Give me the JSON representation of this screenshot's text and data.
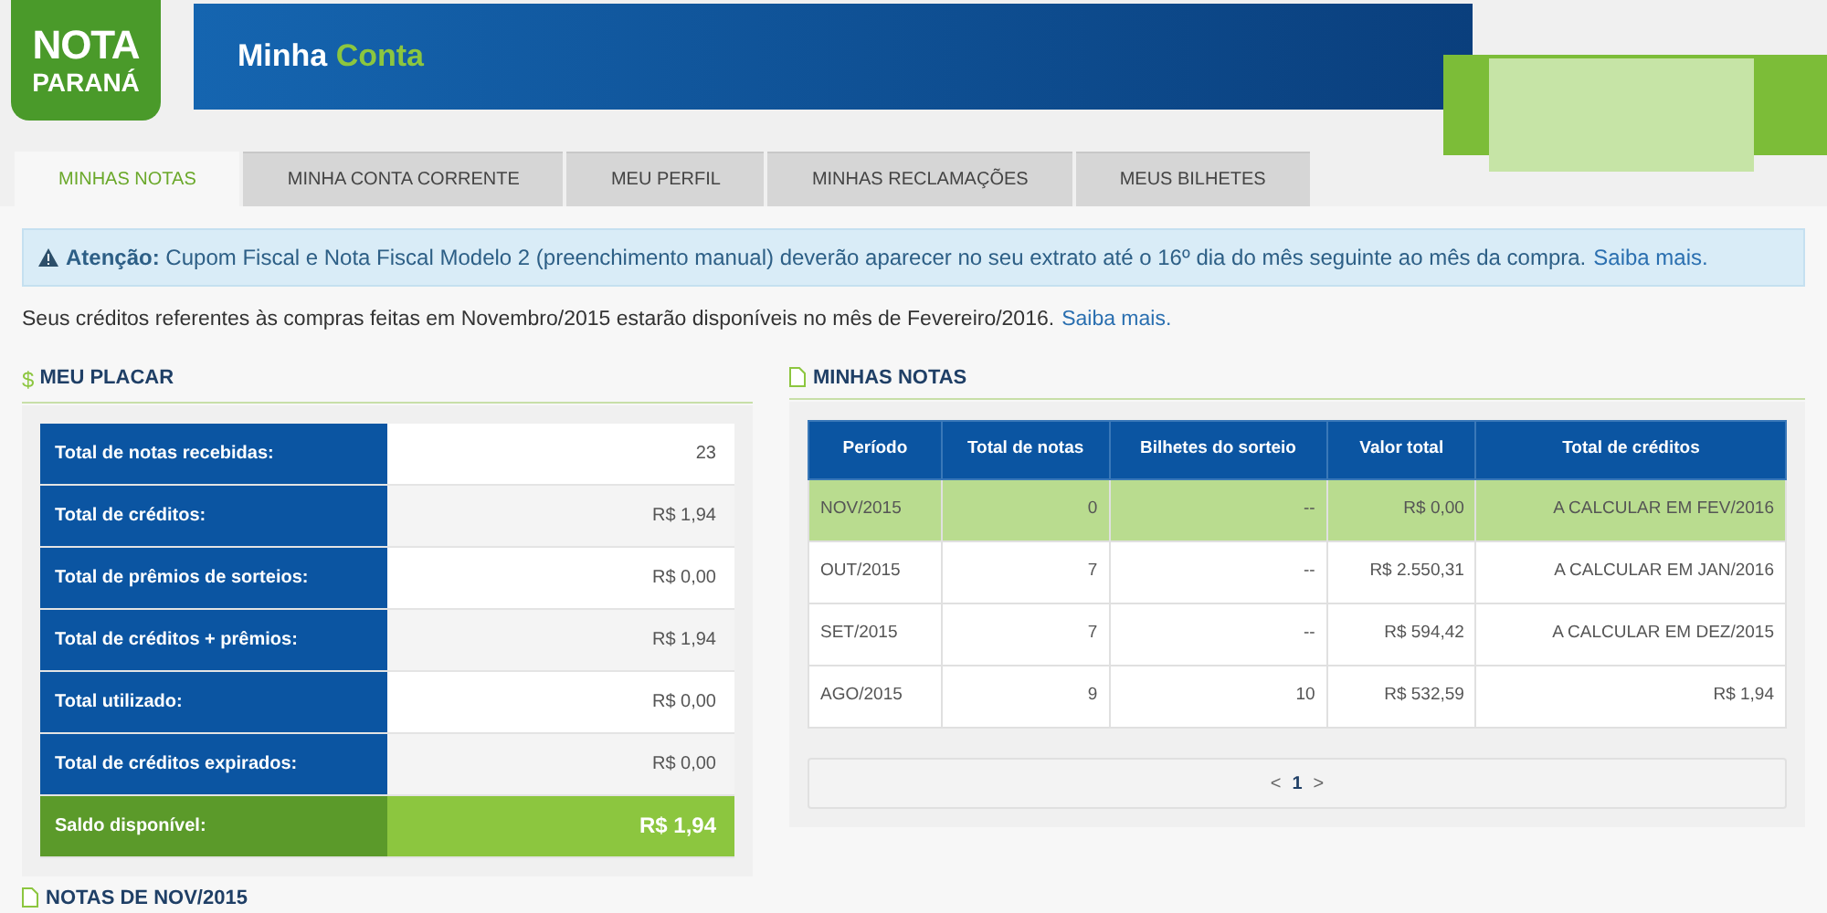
{
  "logo": {
    "line1": "NOTA",
    "line2": "PARANÁ"
  },
  "header": {
    "title_part1": "Minha",
    "title_part2": "Conta"
  },
  "tabs": [
    {
      "label": "MINHAS NOTAS",
      "selected": true
    },
    {
      "label": "MINHA CONTA CORRENTE",
      "selected": false
    },
    {
      "label": "MEU PERFIL",
      "selected": false
    },
    {
      "label": "MINHAS RECLAMAÇÕES",
      "selected": false
    },
    {
      "label": "MEUS BILHETES",
      "selected": false
    }
  ],
  "alert": {
    "text": "**Atenção:** Cupom Fiscal e Nota Fiscal Modelo 2 (preenchimento manual) deverão aparecer no seu extrato até o 16º dia do mês seguinte ao mês da compra.",
    "link": "Saiba mais."
  },
  "notice": {
    "text": "Seus créditos referentes às compras feitas em Novembro/2015 estarão disponíveis no mês de Fevereiro/2016.",
    "link": "Saiba mais."
  },
  "placar": {
    "icon": "$",
    "title": "MEU PLACAR",
    "rows": [
      {
        "label": "Total de notas recebidas:",
        "value": "23",
        "kind": "normal"
      },
      {
        "label": "Total de créditos:",
        "value": "R$ 1,94",
        "kind": "normal"
      },
      {
        "label": "Total de prêmios de sorteios:",
        "value": "R$ 0,00",
        "kind": "normal"
      },
      {
        "label": "Total de créditos + prêmios:",
        "value": "R$ 1,94",
        "kind": "normal"
      },
      {
        "label": "Total utilizado:",
        "value": "R$ 0,00",
        "kind": "normal"
      },
      {
        "label": "Total de créditos expirados:",
        "value": "R$ 0,00",
        "kind": "normal"
      },
      {
        "label": "Saldo disponível:",
        "value": "R$ 1,94",
        "kind": "total"
      }
    ]
  },
  "notas": {
    "title": "MINHAS NOTAS",
    "columns": [
      "Período",
      "Total de notas",
      "Bilhetes do sorteio",
      "Valor total",
      "Total de créditos"
    ],
    "rows": [
      {
        "cells": [
          "NOV/2015",
          "0",
          "--",
          "R$ 0,00",
          "A CALCULAR EM FEV/2016"
        ],
        "highlighted": true
      },
      {
        "cells": [
          "OUT/2015",
          "7",
          "--",
          "R$ 2.550,31",
          "A CALCULAR EM JAN/2016"
        ],
        "highlighted": false
      },
      {
        "cells": [
          "SET/2015",
          "7",
          "--",
          "R$ 594,42",
          "A CALCULAR EM DEZ/2015"
        ],
        "highlighted": false
      },
      {
        "cells": [
          "AGO/2015",
          "9",
          "10",
          "R$ 532,59",
          "R$ 1,94"
        ],
        "highlighted": false
      }
    ],
    "pagination": {
      "prev": "<",
      "page": "1",
      "next": ">"
    }
  },
  "next_section": {
    "title": "NOTAS DE NOV/2015"
  }
}
